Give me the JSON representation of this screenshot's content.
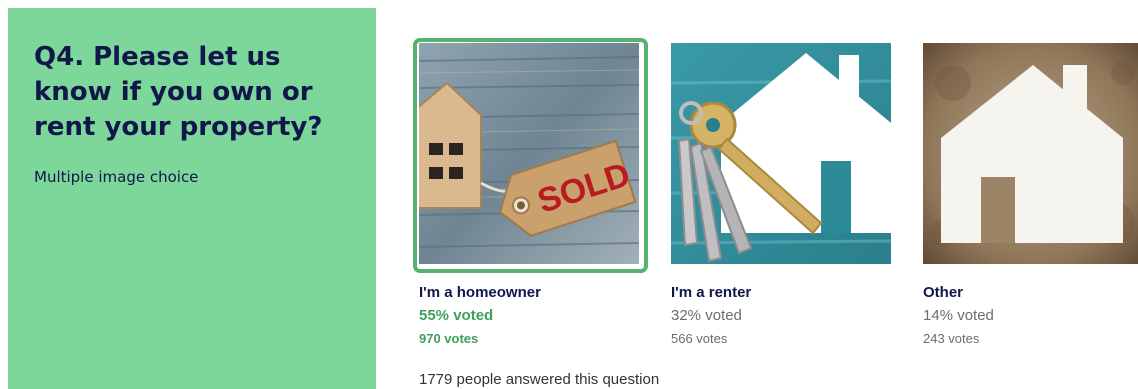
{
  "question": {
    "title": "Q4. Please let us know if you own or rent your property?",
    "type_label": "Multiple image choice"
  },
  "options": [
    {
      "label": "I'm a homeowner",
      "percent_text": "55% voted",
      "votes_text": "970 votes",
      "selected": true,
      "image_icon": "house-sold-tag-icon",
      "tag_text": "SOLD"
    },
    {
      "label": "I'm a renter",
      "percent_text": "32% voted",
      "votes_text": "566 votes",
      "selected": false,
      "image_icon": "house-keys-icon"
    },
    {
      "label": "Other",
      "percent_text": "14% voted",
      "votes_text": "243 votes",
      "selected": false,
      "image_icon": "paper-house-icon"
    }
  ],
  "footer": {
    "total_text": "1779 people answered this question"
  },
  "colors": {
    "panel_bg": "#7dd69a",
    "title_color": "#11174a",
    "selected_accent": "#56b26e"
  }
}
